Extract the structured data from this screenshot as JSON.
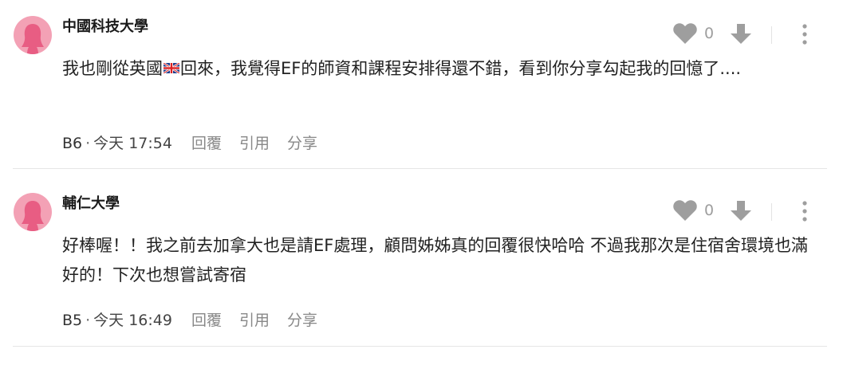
{
  "comments": [
    {
      "author": "中國科技大學",
      "likes": "0",
      "text_before": "我也剛從英國",
      "flag_icon": "uk-flag-icon",
      "text_after": "回來，我覺得EF的師資和課程安排得還不錯，看到你分享勾起我的回憶了....",
      "floor": "B6",
      "time": "今天 17:54",
      "reply_label": "回覆",
      "quote_label": "引用",
      "share_label": "分享"
    },
    {
      "author": "輔仁大學",
      "likes": "0",
      "text_before": "好棒喔！！我之前去加拿大也是請EF處理，顧問姊姊真的回覆很快哈哈 不過我那次是住宿舍環境也滿好的！下次也想嘗試寄宿",
      "floor": "B5",
      "time": "今天 16:49",
      "reply_label": "回覆",
      "quote_label": "引用",
      "share_label": "分享"
    }
  ],
  "colors": {
    "avatar_bg": "#f3a1b5",
    "avatar_figure": "#e85d83",
    "icon_gray": "#9e9e9e",
    "action_text": "#888888"
  }
}
